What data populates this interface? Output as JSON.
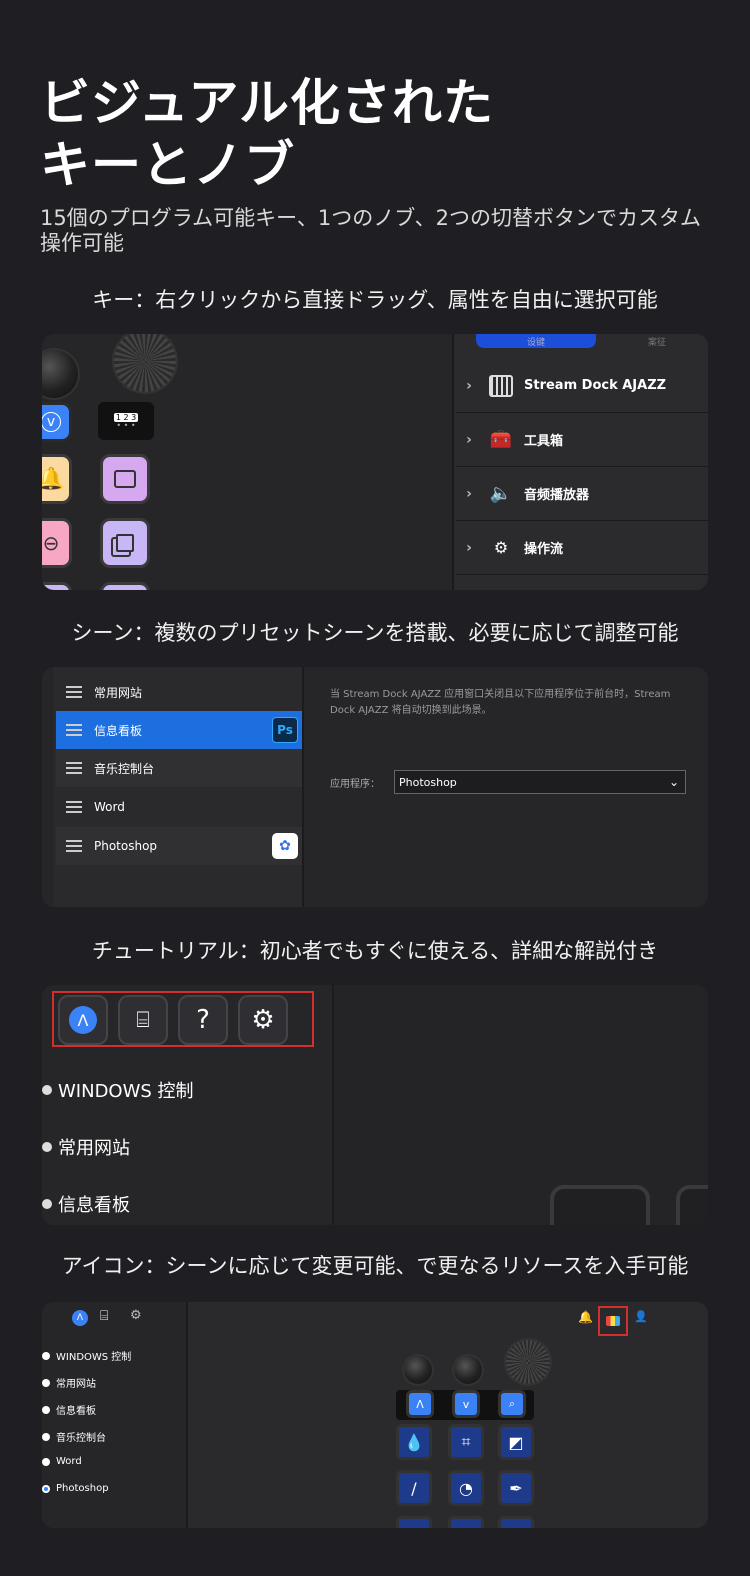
{
  "hero": {
    "line1": "ビジュアル化された",
    "line2": "キーとノブ"
  },
  "subtitle": "15個のプログラム可能キー、1つのノブ、2つの切替ボタンでカスタム操作可能",
  "captions": {
    "keys": "キー：右クリックから直接ドラッグ、属性を自由に選択可能",
    "scenes": "シーン：複数のプリセットシーンを搭載、必要に応じて調整可能",
    "tutorial": "チュートリアル：初心者でもすぐに使える、詳細な解説付き",
    "icons": "アイコン：シーンに応じて変更可能、で更なるリソースを入手可能"
  },
  "panel1": {
    "tab_left": "设键",
    "tab_right": "案征",
    "page_indicator": "1 2 3",
    "tree": [
      {
        "label": "Stream Dock AJAZZ",
        "icon": "grid-icon"
      },
      {
        "label": "工具箱",
        "icon": "toolbox-icon"
      },
      {
        "label": "音频播放器",
        "icon": "speaker-icon"
      },
      {
        "label": "操作流",
        "icon": "flow-icon"
      }
    ],
    "colors": {
      "accent": "#3b82f6",
      "bell_key": "#fcd9a0",
      "monitor_key": "#d6a8f0",
      "zoom_key": "#f7a6c4",
      "copy_key": "#c9b6f7"
    }
  },
  "panel2": {
    "scenes": [
      {
        "label": "常用网站"
      },
      {
        "label": "信息看板",
        "badge": "Ps"
      },
      {
        "label": "音乐控制台"
      },
      {
        "label": "Word"
      },
      {
        "label": "Photoshop"
      }
    ],
    "description": "当 Stream Dock AJAZZ 应用窗口关闭且以下应用程序位于前台时，Stream Dock AJAZZ 将自动切换到此场景。",
    "app_label": "应用程序：",
    "app_value": "Photoshop",
    "colors": {
      "selected": "#1d6fe0",
      "ps_badge": "#0b2a4a"
    }
  },
  "panel3": {
    "toolbar": [
      {
        "icon": "a-logo-icon"
      },
      {
        "icon": "presentation-icon"
      },
      {
        "icon": "help-icon",
        "glyph": "?"
      },
      {
        "icon": "gear-icon",
        "glyph": "⚙"
      }
    ],
    "items": [
      "WINDOWS 控制",
      "常用网站",
      "信息看板"
    ],
    "colors": {
      "highlight_border": "#d32f2f"
    }
  },
  "panel4": {
    "list": [
      "WINDOWS 控制",
      "常用网站",
      "信息看板",
      "音乐控制台",
      "Word",
      "Photoshop"
    ],
    "selected": "Photoshop",
    "colors": {
      "key_bg": "#1e3a8a",
      "highlight_border": "#d32f2f"
    }
  }
}
